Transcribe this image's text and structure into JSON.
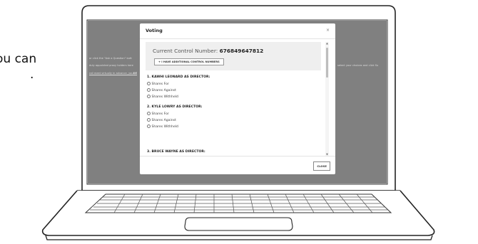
{
  "background": {
    "lines": [
      "ou can",
      "."
    ]
  },
  "screen": {
    "bg_lines": [
      "or click the \"Ask a Question\" butt",
      "duly appointed proxy holders here",
      "rall meet virtually in advance, you",
      "select your choices and click Su"
    ],
    "bg_strong": "DE"
  },
  "modal": {
    "title": "Voting",
    "close_icon": "×",
    "control_label": "Current Control Number:",
    "control_number": "676849647812",
    "add_button": "+ I HAVE ADDITIONAL CONTROL NUMBERS",
    "questions": [
      {
        "title": "1. KAWHI LEONARD AS DIRECTOR:",
        "options": [
          "Shares For",
          "Shares Against",
          "Shares Withheld"
        ]
      },
      {
        "title": "2. KYLE LOWRY AS DIRECTOR:",
        "options": [
          "Shares For",
          "Shares Against",
          "Shares Withheld"
        ]
      },
      {
        "title": "3. BRUCE WAYNE AS DIRECTOR:",
        "options": []
      }
    ],
    "close_button": "CLOSE"
  },
  "icons": {
    "scroll_up": "▲",
    "scroll_down": "▼"
  },
  "colors": {
    "screen_bg": "#808080",
    "modal_bg": "#ffffff",
    "control_box_bg": "#efefef"
  }
}
